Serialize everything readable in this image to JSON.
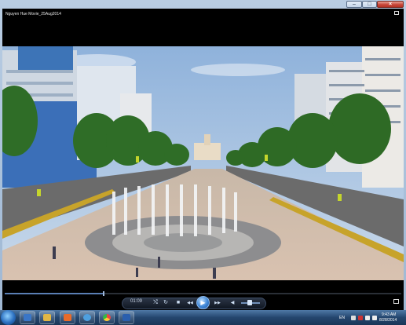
{
  "window": {
    "title": "Nguyen Hue Movie_25Aug2014",
    "controls": {
      "minimize": "–",
      "maximize": "□",
      "close": "×"
    }
  },
  "player": {
    "time_elapsed": "01:09",
    "progress_fraction": 0.25,
    "volume_fraction": 0.45,
    "icons": [
      "shuffle-icon",
      "repeat-icon",
      "stop-icon",
      "previous-icon",
      "play-icon",
      "next-icon",
      "mute-icon",
      "volume-icon",
      "fullscreen-icon"
    ],
    "labels": {
      "shuffle": "⤭",
      "repeat": "↻",
      "stop": "■",
      "previous": "◀◀",
      "play": "▶",
      "next": "▶▶",
      "mute": "◀"
    }
  },
  "taskbar": {
    "apps": [
      "windows-explorer-icon",
      "file-manager-icon",
      "media-app-icon",
      "media-player-icon",
      "chrome-icon",
      "word-icon"
    ],
    "tray": {
      "language": "EN",
      "time": "9:43 AM",
      "date": "8/28/2014"
    }
  },
  "colors": {
    "sky": "#a9c6e6",
    "pavement": "#d8c5b5",
    "tree": "#2f6d27",
    "taskbar": "#24466e"
  }
}
